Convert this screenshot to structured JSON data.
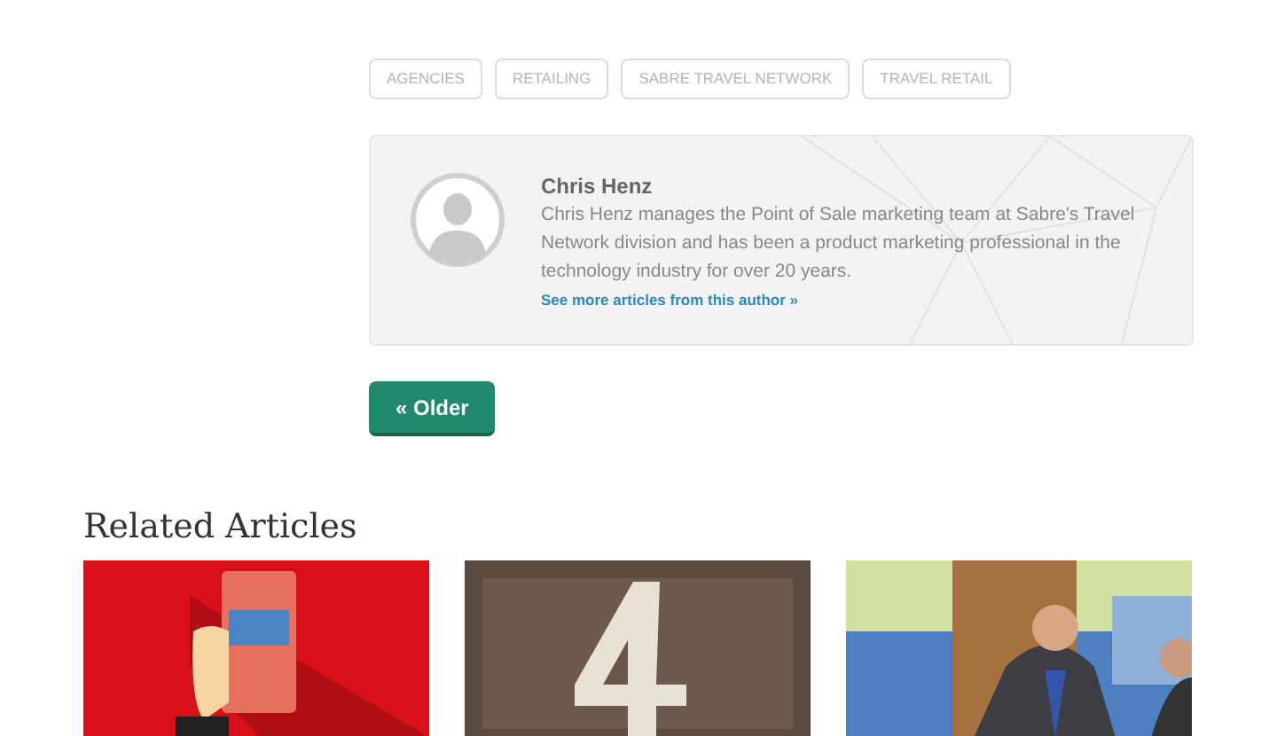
{
  "tags": [
    "AGENCIES",
    "RETAILING",
    "SABRE TRAVEL NETWORK",
    "TRAVEL RETAIL"
  ],
  "author": {
    "name": "Chris Henz",
    "bio": "Chris Henz manages the Point of Sale marketing team at Sabre's Travel Network division and has been a product marketing professional in the technology industry for over 20 years.",
    "link": "See more articles from this author »"
  },
  "older_button": "« Older",
  "related": {
    "title": "Related Articles"
  }
}
